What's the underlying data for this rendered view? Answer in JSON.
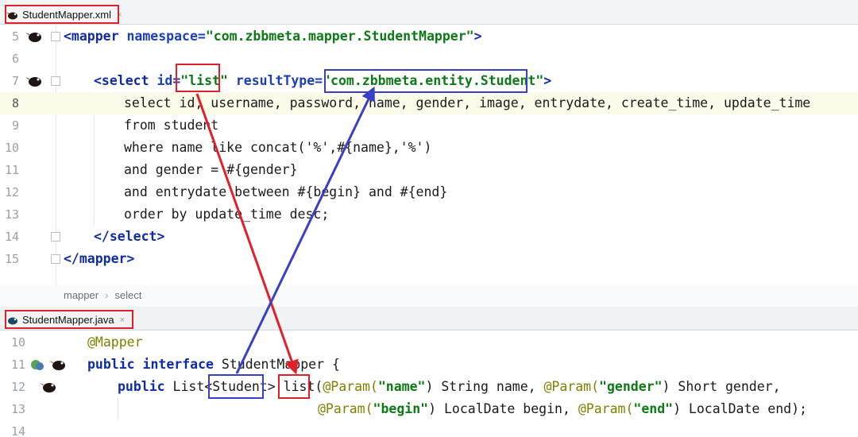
{
  "tabs": {
    "xml": {
      "label": "StudentMapper.xml",
      "close": "×"
    },
    "java": {
      "label": "StudentMapper.java",
      "close": "×"
    }
  },
  "xml_lines": [
    {
      "num": "5",
      "current": false
    },
    {
      "num": "6",
      "current": false
    },
    {
      "num": "7",
      "current": false
    },
    {
      "num": "8",
      "current": true
    },
    {
      "num": "9",
      "current": false
    },
    {
      "num": "10",
      "current": false
    },
    {
      "num": "11",
      "current": false
    },
    {
      "num": "12",
      "current": false
    },
    {
      "num": "13",
      "current": false
    },
    {
      "num": "14",
      "current": false
    },
    {
      "num": "15",
      "current": false
    }
  ],
  "xml_code": {
    "l5": {
      "open": "<mapper",
      "attr": " namespace=",
      "val": "\"com.zbbmeta.mapper.StudentMapper\"",
      "close": ">"
    },
    "l7": {
      "open": "<select",
      "attr1": " id=",
      "val1": "\"list\"",
      "attr2": " resultType=",
      "val2": "\"com.zbbmeta.entity.Student\"",
      "close": ">"
    },
    "l8": "select id, username, password, name, gender, image, entrydate, create_time, update_time",
    "l9": "from student",
    "l10": "where name like concat('%',#{name},'%')",
    "l11": "and gender = #{gender}",
    "l12": "and entrydate between #{begin} and #{end}",
    "l13": "order by update_time desc;",
    "l14": "</select>",
    "l15": "</mapper>"
  },
  "breadcrumb": {
    "root": "mapper",
    "sep": "›",
    "leaf": "select"
  },
  "java_lines": [
    {
      "num": "10"
    },
    {
      "num": "11"
    },
    {
      "num": "12"
    },
    {
      "num": "13"
    },
    {
      "num": "14"
    }
  ],
  "java_code": {
    "l10": "@Mapper",
    "l11": {
      "kw1": "public",
      "kw2": " interface",
      "name": " StudentMapper {"
    },
    "l12": {
      "kw": "public",
      "t1": " List<",
      "t2": "Student",
      "t3": "> ",
      "method": "list",
      "t4": "(",
      "an1": "@Param(",
      "s1": "\"name\"",
      "t5": ") String name, ",
      "an2": "@Param(",
      "s2": "\"gender\"",
      "t6": ") Short gender,"
    },
    "l13": {
      "an1": "@Param(",
      "s1": "\"begin\"",
      "t1": ") LocalDate begin, ",
      "an2": "@Param(",
      "s2": "\"end\"",
      "t2": ") LocalDate end);"
    }
  },
  "colors": {
    "highlight_red": "#e0202a",
    "highlight_blue": "#3a3fc8",
    "xml_tag": "#0e2ba8",
    "string": "#0d7a15",
    "annotation": "#808000"
  }
}
